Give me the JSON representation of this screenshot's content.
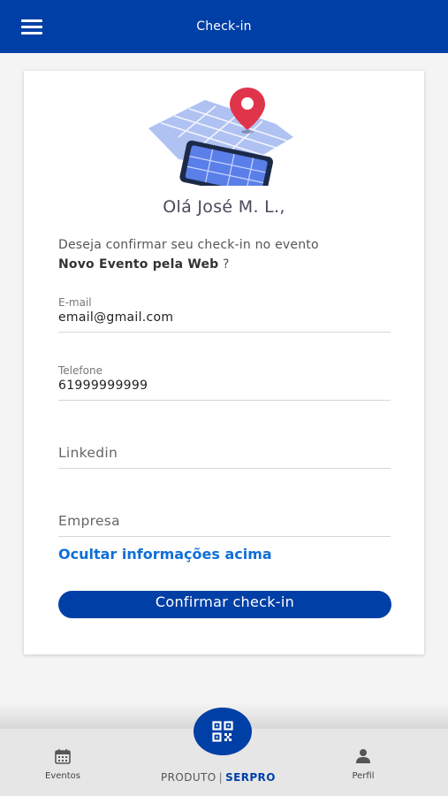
{
  "header": {
    "title": "Check-in",
    "menu_icon": "hamburger-menu-icon"
  },
  "card": {
    "illustration": "map-location-pin-icon",
    "greeting": "Olá José M. L.,",
    "question_prefix": "Deseja confirmar seu check-in no evento",
    "event_name": "Novo Evento pela Web",
    "question_suffix": " ?",
    "fields": {
      "email": {
        "label": "E-mail",
        "value": "email@gmail.com"
      },
      "phone": {
        "label": "Telefone",
        "value": "61999999999"
      },
      "linkedin": {
        "placeholder": "Linkedin"
      },
      "company": {
        "placeholder": "Empresa"
      }
    },
    "toggle_link": "Ocultar informações acima",
    "confirm_button": "Confirmar check-in"
  },
  "bottom_nav": {
    "eventos": {
      "label": "Eventos",
      "icon": "calendar-icon"
    },
    "perfil": {
      "label": "Perfil",
      "icon": "person-icon"
    },
    "fab_icon": "qr-code-icon"
  },
  "brand": {
    "produto": "PRODUTO",
    "serpro": "SERPRO"
  },
  "colors": {
    "primary": "#003fa6",
    "link": "#0f6fd6",
    "map_blue": "#5b7fe8",
    "pin_red": "#e0344b"
  }
}
